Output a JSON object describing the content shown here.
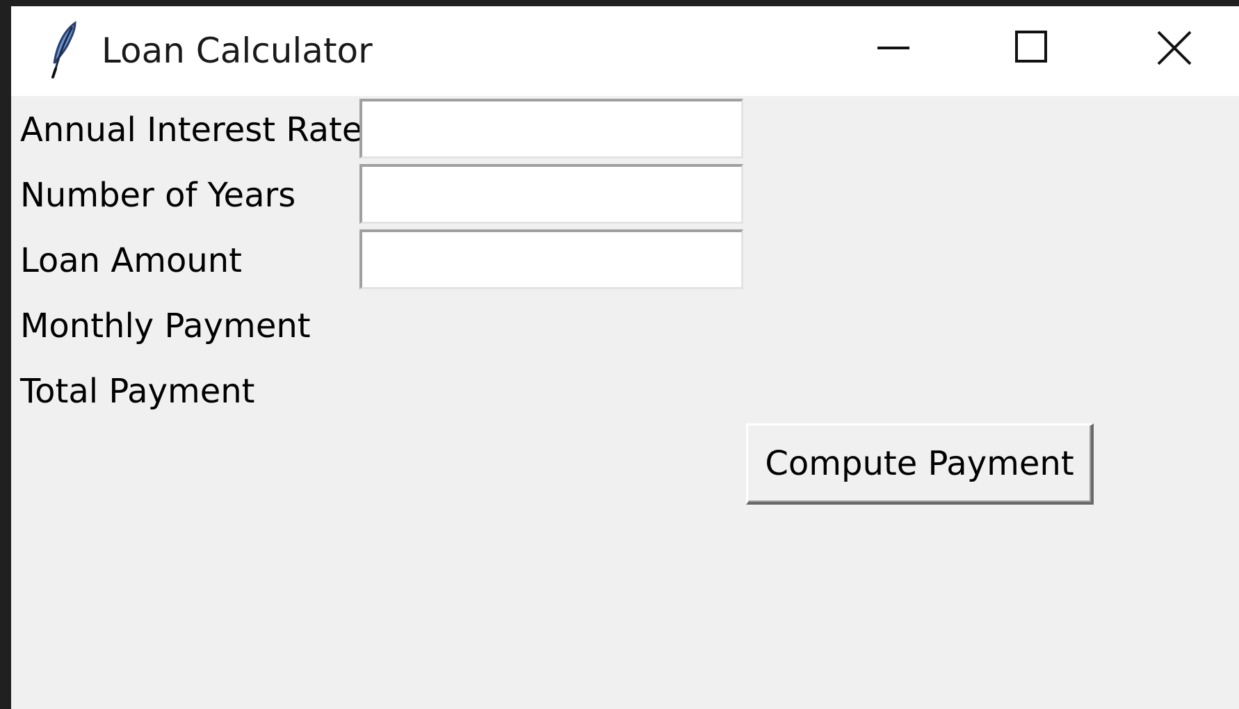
{
  "window": {
    "title": "Loan Calculator",
    "icons": {
      "app": "feather-icon",
      "minimize": "minimize-icon",
      "maximize": "maximize-icon",
      "close": "close-icon"
    }
  },
  "form": {
    "annual_interest_rate": {
      "label": "Annual Interest Rate",
      "value": ""
    },
    "number_of_years": {
      "label": "Number of Years",
      "value": ""
    },
    "loan_amount": {
      "label": "Loan Amount",
      "value": ""
    },
    "monthly_payment": {
      "label": "Monthly Payment",
      "value": ""
    },
    "total_payment": {
      "label": "Total Payment",
      "value": ""
    },
    "compute_button_label": "Compute Payment"
  },
  "colors": {
    "window_background": "#f0f0f0",
    "titlebar_background": "#ffffff",
    "screen_background": "#202020"
  }
}
